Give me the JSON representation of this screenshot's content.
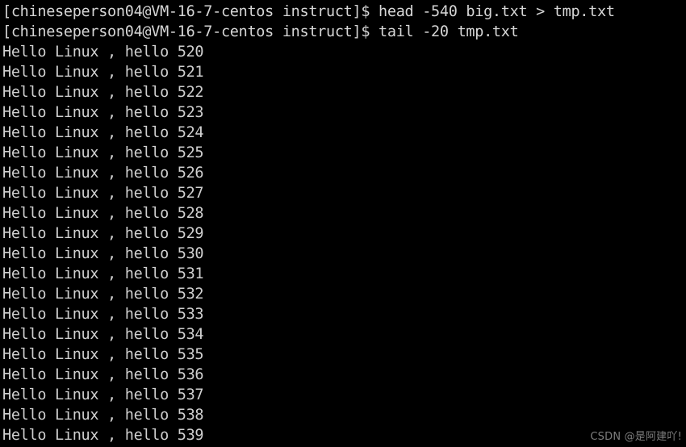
{
  "terminal": {
    "background_color": "#000000",
    "text_color": "#d0d0d0",
    "prompt_user": "chineseperson04",
    "prompt_host": "VM-16-7-centos",
    "prompt_dir": "instruct",
    "prompt_symbol": "$",
    "lines": [
      {
        "type": "prompt",
        "text": "[chineseperson04@VM-16-7-centos instruct]$ head -540 big.txt > tmp.txt"
      },
      {
        "type": "prompt",
        "text": "[chineseperson04@VM-16-7-centos instruct]$ tail -20 tmp.txt"
      },
      {
        "type": "output",
        "text": "Hello Linux , hello 520"
      },
      {
        "type": "output",
        "text": "Hello Linux , hello 521"
      },
      {
        "type": "output",
        "text": "Hello Linux , hello 522"
      },
      {
        "type": "output",
        "text": "Hello Linux , hello 523"
      },
      {
        "type": "output",
        "text": "Hello Linux , hello 524"
      },
      {
        "type": "output",
        "text": "Hello Linux , hello 525"
      },
      {
        "type": "output",
        "text": "Hello Linux , hello 526"
      },
      {
        "type": "output",
        "text": "Hello Linux , hello 527"
      },
      {
        "type": "output",
        "text": "Hello Linux , hello 528"
      },
      {
        "type": "output",
        "text": "Hello Linux , hello 529"
      },
      {
        "type": "output",
        "text": "Hello Linux , hello 530"
      },
      {
        "type": "output",
        "text": "Hello Linux , hello 531"
      },
      {
        "type": "output",
        "text": "Hello Linux , hello 532"
      },
      {
        "type": "output",
        "text": "Hello Linux , hello 533"
      },
      {
        "type": "output",
        "text": "Hello Linux , hello 534"
      },
      {
        "type": "output",
        "text": "Hello Linux , hello 535"
      },
      {
        "type": "output",
        "text": "Hello Linux , hello 536"
      },
      {
        "type": "output",
        "text": "Hello Linux , hello 537"
      },
      {
        "type": "output",
        "text": "Hello Linux , hello 538"
      },
      {
        "type": "output",
        "text": "Hello Linux , hello 539"
      }
    ]
  },
  "watermark": {
    "text": "CSDN @是阿建吖!",
    "color": "#7e7e7e"
  }
}
